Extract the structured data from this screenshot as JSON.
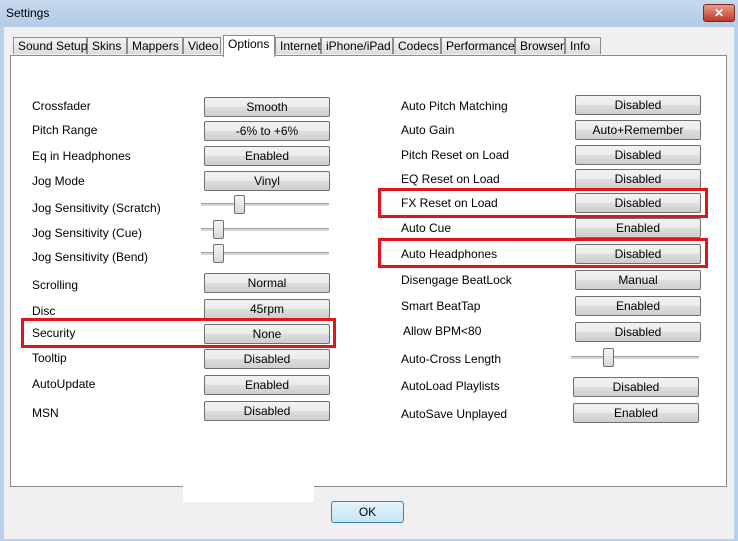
{
  "window": {
    "title": "Settings",
    "close_glyph": "✕"
  },
  "tabs": [
    "Sound Setup",
    "Skins",
    "Mappers",
    "Video",
    "Options",
    "Internet",
    "iPhone/iPad",
    "Codecs",
    "Performances",
    "Browser",
    "Info"
  ],
  "active_tab": "Options",
  "left": {
    "crossfader": {
      "label": "Crossfader",
      "value": "Smooth"
    },
    "pitch_range": {
      "label": "Pitch Range",
      "value": "-6% to +6%"
    },
    "eq_headphones": {
      "label": "Eq in Headphones",
      "value": "Enabled"
    },
    "jog_mode": {
      "label": "Jog Mode",
      "value": "Vinyl"
    },
    "jog_scratch": {
      "label": "Jog Sensitivity (Scratch)",
      "level": 0.28
    },
    "jog_cue": {
      "label": "Jog Sensitivity (Cue)",
      "level": 0.1
    },
    "jog_bend": {
      "label": "Jog Sensitivity (Bend)",
      "level": 0.1
    },
    "scrolling": {
      "label": "Scrolling",
      "value": "Normal"
    },
    "disc": {
      "label": "Disc",
      "value": "45rpm"
    },
    "security": {
      "label": "Security",
      "value": "None"
    },
    "tooltip": {
      "label": "Tooltip",
      "value": "Disabled"
    },
    "autoupdate": {
      "label": "AutoUpdate",
      "value": "Enabled"
    },
    "msn": {
      "label": "MSN",
      "value": "Disabled"
    }
  },
  "right": {
    "auto_pitch": {
      "label": "Auto Pitch Matching",
      "value": "Disabled"
    },
    "auto_gain": {
      "label": "Auto Gain",
      "value": "Auto+Remember"
    },
    "pitch_reset": {
      "label": "Pitch Reset on Load",
      "value": "Disabled"
    },
    "eq_reset": {
      "label": "EQ Reset on Load",
      "value": "Disabled"
    },
    "fx_reset": {
      "label": "FX Reset on Load",
      "value": "Disabled"
    },
    "auto_cue": {
      "label": "Auto Cue",
      "value": "Enabled"
    },
    "auto_headphones": {
      "label": "Auto Headphones",
      "value": "Disabled"
    },
    "disengage_beatlock": {
      "label": "Disengage BeatLock",
      "value": "Manual"
    },
    "smart_beattap": {
      "label": "Smart BeatTap",
      "value": "Enabled"
    },
    "allow_bpm": {
      "label": "Allow BPM<80",
      "value": "Disabled"
    },
    "auto_cross": {
      "label": "Auto-Cross Length",
      "level": 0.27
    },
    "autoload": {
      "label": "AutoLoad Playlists",
      "value": "Disabled"
    },
    "autosave": {
      "label": "AutoSave Unplayed",
      "value": "Enabled"
    }
  },
  "footer": {
    "ok_label": "OK"
  },
  "colors": {
    "highlight": "#e0161f",
    "window_frame": "#b9d1ea"
  }
}
